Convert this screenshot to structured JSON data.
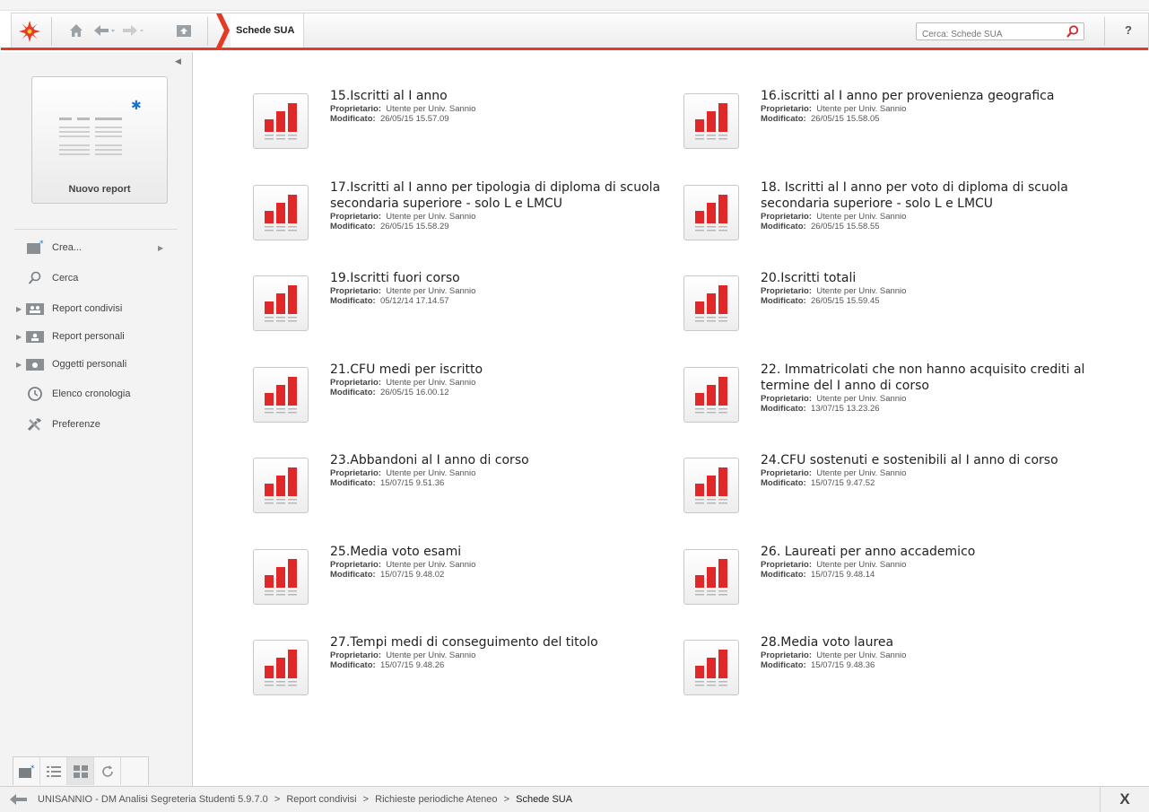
{
  "toolbar": {
    "breadcrumb_label": "Schede SUA",
    "search_placeholder": "Cerca: Schede SUA",
    "help_label": "?"
  },
  "sidebar": {
    "new_report_label": "Nuovo report",
    "items": [
      {
        "label": "Crea...",
        "icon": "create-icon"
      },
      {
        "label": "Cerca",
        "icon": "search-icon"
      },
      {
        "label": "Report condivisi",
        "icon": "shared-reports-icon"
      },
      {
        "label": "Report personali",
        "icon": "personal-reports-icon"
      },
      {
        "label": "Oggetti personali",
        "icon": "personal-objects-icon"
      },
      {
        "label": "Elenco cronologia",
        "icon": "history-icon"
      },
      {
        "label": "Preferenze",
        "icon": "preferences-icon"
      }
    ]
  },
  "reports": [
    {
      "title": "15.Iscritti al I anno",
      "owner_label": "Proprietario:",
      "owner": "Utente per Univ. Sannio",
      "modified_label": "Modificato:",
      "modified": "26/05/15 15.57.09"
    },
    {
      "title": "16.iscritti al I anno per provenienza geografica",
      "owner_label": "Proprietario:",
      "owner": "Utente per Univ. Sannio",
      "modified_label": "Modificato:",
      "modified": "26/05/15 15.58.05"
    },
    {
      "title": "17.Iscritti al I anno per tipologia di diploma di scuola secondaria superiore - solo L e LMCU",
      "owner_label": "Proprietario:",
      "owner": "Utente per Univ. Sannio",
      "modified_label": "Modificato:",
      "modified": "26/05/15 15.58.29"
    },
    {
      "title": "18. Iscritti al I anno per voto di diploma di scuola secondaria superiore - solo L e LMCU",
      "owner_label": "Proprietario:",
      "owner": "Utente per Univ. Sannio",
      "modified_label": "Modificato:",
      "modified": "26/05/15 15.58.55"
    },
    {
      "title": "19.Iscritti fuori corso",
      "owner_label": "Proprietario:",
      "owner": "Utente per Univ. Sannio",
      "modified_label": "Modificato:",
      "modified": "05/12/14 17.14.57"
    },
    {
      "title": "20.Iscritti totali",
      "owner_label": "Proprietario:",
      "owner": "Utente per Univ. Sannio",
      "modified_label": "Modificato:",
      "modified": "26/05/15 15.59.45"
    },
    {
      "title": "21.CFU medi per iscritto",
      "owner_label": "Proprietario:",
      "owner": "Utente per Univ. Sannio",
      "modified_label": "Modificato:",
      "modified": "26/05/15 16.00.12"
    },
    {
      "title": "22. Immatricolati che non hanno acquisito crediti al termine del I anno di corso",
      "owner_label": "Proprietario:",
      "owner": "Utente per Univ. Sannio",
      "modified_label": "Modificato:",
      "modified": "13/07/15 13.23.26"
    },
    {
      "title": "23.Abbandoni al I anno di corso",
      "owner_label": "Proprietario:",
      "owner": "Utente per Univ. Sannio",
      "modified_label": "Modificato:",
      "modified": "15/07/15 9.51.36"
    },
    {
      "title": "24.CFU sostenuti e sostenibili al I anno di corso",
      "owner_label": "Proprietario:",
      "owner": "Utente per Univ. Sannio",
      "modified_label": "Modificato:",
      "modified": "15/07/15 9.47.52"
    },
    {
      "title": "25.Media voto esami",
      "owner_label": "Proprietario:",
      "owner": "Utente per Univ. Sannio",
      "modified_label": "Modificato:",
      "modified": "15/07/15 9.48.02"
    },
    {
      "title": "26. Laureati per anno accademico",
      "owner_label": "Proprietario:",
      "owner": "Utente per Univ. Sannio",
      "modified_label": "Modificato:",
      "modified": "15/07/15 9.48.14"
    },
    {
      "title": "27.Tempi medi di conseguimento del titolo",
      "owner_label": "Proprietario:",
      "owner": "Utente per Univ. Sannio",
      "modified_label": "Modificato:",
      "modified": "15/07/15 9.48.26"
    },
    {
      "title": "28.Media voto laurea",
      "owner_label": "Proprietario:",
      "owner": "Utente per Univ. Sannio",
      "modified_label": "Modificato:",
      "modified": "15/07/15 9.48.36"
    }
  ],
  "statusbar": {
    "path": [
      "UNISANNIO - DM Analisi Segreteria Studenti 5.9.7.0",
      ">",
      "Report condivisi",
      ">",
      "Richieste periodiche Ateneo",
      ">"
    ],
    "current": "Schede SUA",
    "close_label": "X"
  },
  "colors": {
    "accent": "#e23a24",
    "chart_red": "#e02828",
    "new_star": "#1a72c8"
  }
}
